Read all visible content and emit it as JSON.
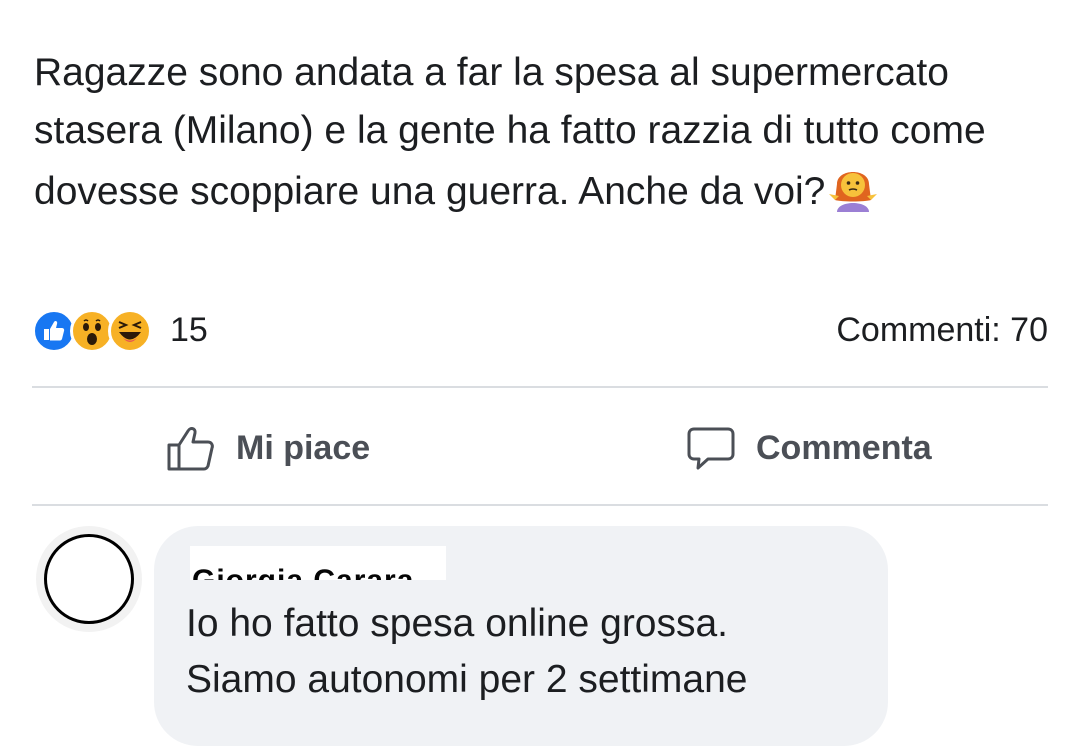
{
  "post": {
    "text": "Ragazze sono andata a far la spesa al supermercato stasera (Milano) e la gente ha fatto razzia di tutto come dovesse scoppiare una guerra. Anche da voi?",
    "trailing_emoji": "person-shrugging-emoji"
  },
  "reactions": {
    "icons": [
      "like-reaction-icon",
      "wow-reaction-icon",
      "haha-reaction-icon"
    ],
    "count": "15",
    "comments_label": "Commenti: 70"
  },
  "actions": {
    "like_label": "Mi piace",
    "comment_label": "Commenta"
  },
  "comment": {
    "author": "Giorgia Carara",
    "text_line1": "Io ho fatto spesa online grossa.",
    "text_line2": "Siamo autonomi per 2 settimane"
  },
  "colors": {
    "like_blue": "#1877f2",
    "reaction_yellow": "#f7b125",
    "action_gray": "#4b4f56",
    "bubble_bg": "#f0f2f5",
    "divider": "#dadde1"
  }
}
